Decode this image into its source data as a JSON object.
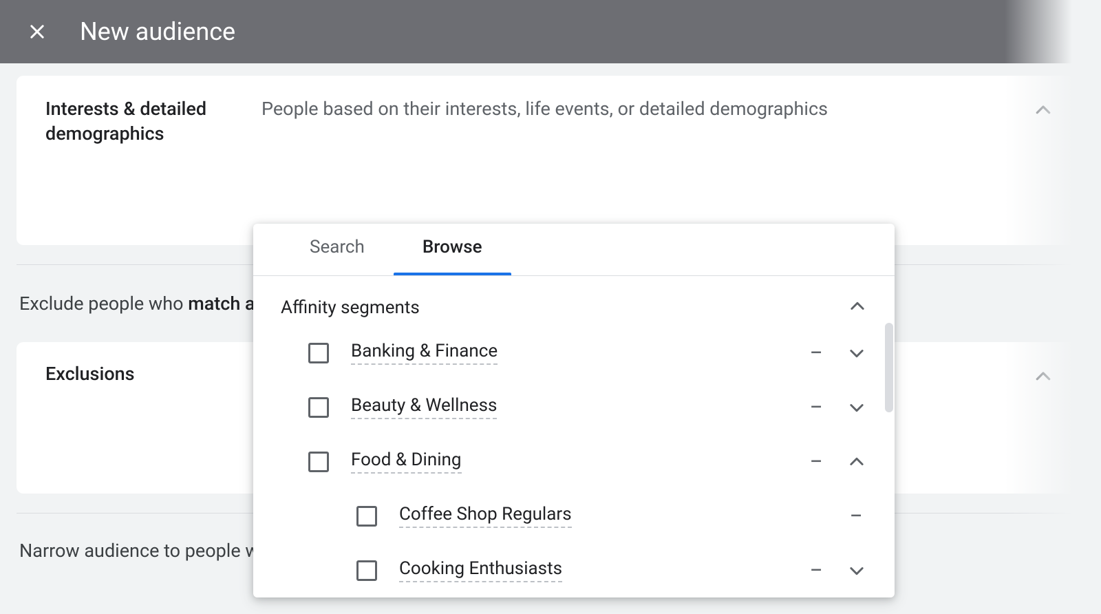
{
  "header": {
    "title": "New audience"
  },
  "interests_card": {
    "title": "Interests & detailed demographics",
    "description": "People based on their interests, life events, or detailed demographics"
  },
  "exclude_text_prefix": "Exclude people who ",
  "exclude_text_strong": "match an",
  "exclusions_card": {
    "title": "Exclusions"
  },
  "narrow_text": "Narrow audience to people wh",
  "dropdown": {
    "tabs": {
      "search": "Search",
      "browse": "Browse"
    },
    "segment_title": "Affinity segments",
    "items": [
      {
        "label": "Banking & Finance",
        "expanded": false,
        "hasChildren": true
      },
      {
        "label": "Beauty & Wellness",
        "expanded": false,
        "hasChildren": true
      },
      {
        "label": "Food & Dining",
        "expanded": true,
        "hasChildren": true
      }
    ],
    "children": [
      {
        "label": "Coffee Shop Regulars",
        "hasChildren": false
      },
      {
        "label": "Cooking Enthusiasts",
        "hasChildren": true
      }
    ]
  }
}
